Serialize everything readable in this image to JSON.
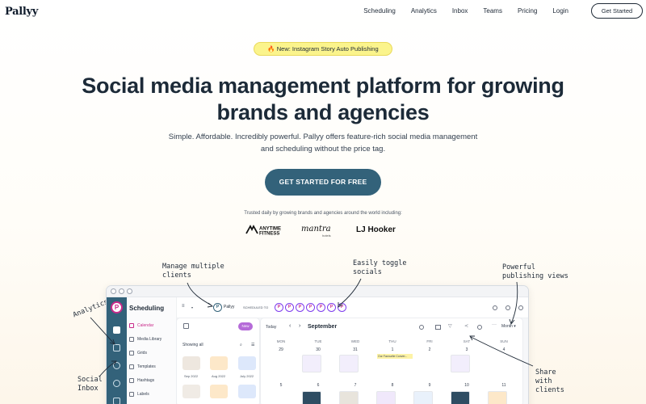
{
  "brand": {
    "logo": "Pallyy"
  },
  "nav": {
    "links": [
      "Scheduling",
      "Analytics",
      "Inbox",
      "Teams",
      "Pricing",
      "Login"
    ],
    "cta": "Get Started"
  },
  "hero": {
    "badge": "🔥 New: Instagram Story Auto Publishing",
    "title_line1": "Social media management platform for growing",
    "title_line2": "brands and agencies",
    "subtitle_line1": "Simple. Affordable. Incredibly powerful. Pallyy offers feature-rich social media management",
    "subtitle_line2": "and scheduling without the price tag.",
    "cta": "GET STARTED FOR FREE"
  },
  "trusted": {
    "text": "Trusted daily by growing brands and agencies around the world including:",
    "logos": [
      "ANYTIME FITNESS",
      "mantra",
      "hotels",
      "LJ Hooker"
    ]
  },
  "annotations": {
    "manage_1": "Manage multiple",
    "manage_2": "clients",
    "toggle_1": "Easily toggle",
    "toggle_2": "socials",
    "powerful_1": "Powerful",
    "powerful_2": "publishing views",
    "analytics": "Analytics",
    "inbox_1": "Social",
    "inbox_2": "Inbox",
    "share_1": "Share",
    "share_2": "with",
    "share_3": "clients"
  },
  "app": {
    "section_title": "Scheduling",
    "sidebar_items": [
      "Calendar",
      "Media Library",
      "Grids",
      "Templates",
      "Hashtags",
      "Labels"
    ],
    "client_label": "Pallyy",
    "scheduled_label": "SCHEDULED TO",
    "new_button": "New",
    "today_button": "Today",
    "month_title": "September",
    "view_select": "Month",
    "showing": "Showing all",
    "folders": [
      "Sep 2022",
      "Aug 2022",
      "July 2022"
    ],
    "weekdays": [
      "MON",
      "TUE",
      "WED",
      "THU",
      "FRI",
      "SAT",
      "SUN"
    ],
    "week1_days": [
      "29",
      "30",
      "31",
      "1",
      "2",
      "3",
      "4"
    ],
    "week2_days": [
      "5",
      "6",
      "7",
      "8",
      "9",
      "10",
      "11"
    ],
    "event_label": "Our Favourite Conver..."
  }
}
